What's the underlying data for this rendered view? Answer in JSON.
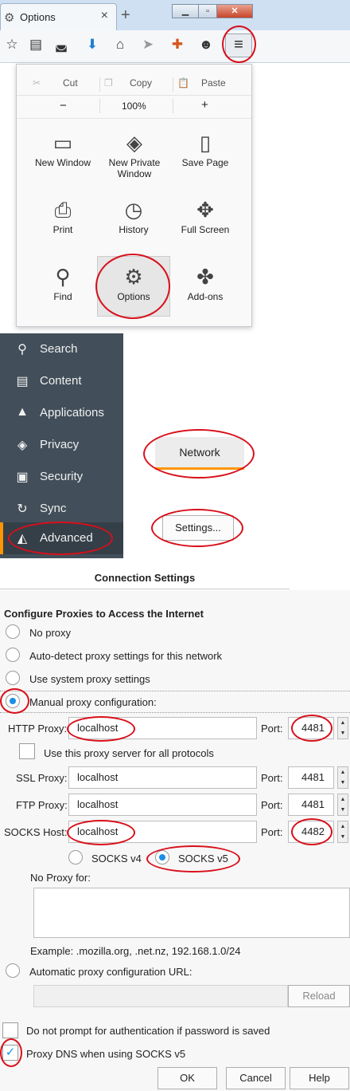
{
  "browser": {
    "tab_title": "Options",
    "new_tab": "+",
    "menu": {
      "cut": "Cut",
      "copy": "Copy",
      "paste": "Paste",
      "zoom_out": "−",
      "zoom": "100%",
      "zoom_in": "+",
      "items": [
        {
          "label": "New Window",
          "icon": "window-icon"
        },
        {
          "label": "New Private Window",
          "icon": "mask-icon"
        },
        {
          "label": "Save Page",
          "icon": "page-icon"
        },
        {
          "label": "Print",
          "icon": "printer-icon"
        },
        {
          "label": "History",
          "icon": "clock-icon"
        },
        {
          "label": "Full Screen",
          "icon": "fullscreen-icon"
        },
        {
          "label": "Find",
          "icon": "magnifier-icon"
        },
        {
          "label": "Options",
          "icon": "gear-icon"
        },
        {
          "label": "Add-ons",
          "icon": "puzzle-icon"
        }
      ]
    }
  },
  "prefs": {
    "sidebar": [
      "Search",
      "Content",
      "Applications",
      "Privacy",
      "Security",
      "Sync",
      "Advanced"
    ],
    "network_tab": "Network",
    "settings_button": "Settings..."
  },
  "dialog": {
    "title": "Connection Settings",
    "heading": "Configure Proxies to Access the Internet",
    "no_proxy": "No proxy",
    "auto_detect": "Auto-detect proxy settings for this network",
    "system": "Use system proxy settings",
    "manual": "Manual proxy configuration:",
    "http_label": "HTTP Proxy:",
    "http_value": "localhost",
    "port_label": "Port:",
    "http_port": "4481",
    "use_all": "Use this proxy server for all protocols",
    "ssl_label": "SSL Proxy:",
    "ssl_value": "localhost",
    "ssl_port": "4481",
    "ftp_label": "FTP Proxy:",
    "ftp_value": "localhost",
    "ftp_port": "4481",
    "socks_label": "SOCKS Host:",
    "socks_value": "localhost",
    "socks_port": "4482",
    "socks_v4": "SOCKS v4",
    "socks_v5": "SOCKS v5",
    "no_proxy_for": "No Proxy for:",
    "example": "Example: .mozilla.org, .net.nz, 192.168.1.0/24",
    "auto_url": "Automatic proxy configuration URL:",
    "reload": "Reload",
    "no_prompt": "Do not prompt for authentication if password is saved",
    "proxy_dns": "Proxy DNS when using SOCKS v5",
    "ok": "OK",
    "cancel": "Cancel",
    "help": "Help"
  },
  "colors": {
    "annotation": "#d80f1a",
    "accent": "#ff9500",
    "radio": "#1a8fe6",
    "sidebar": "#424f5a"
  }
}
